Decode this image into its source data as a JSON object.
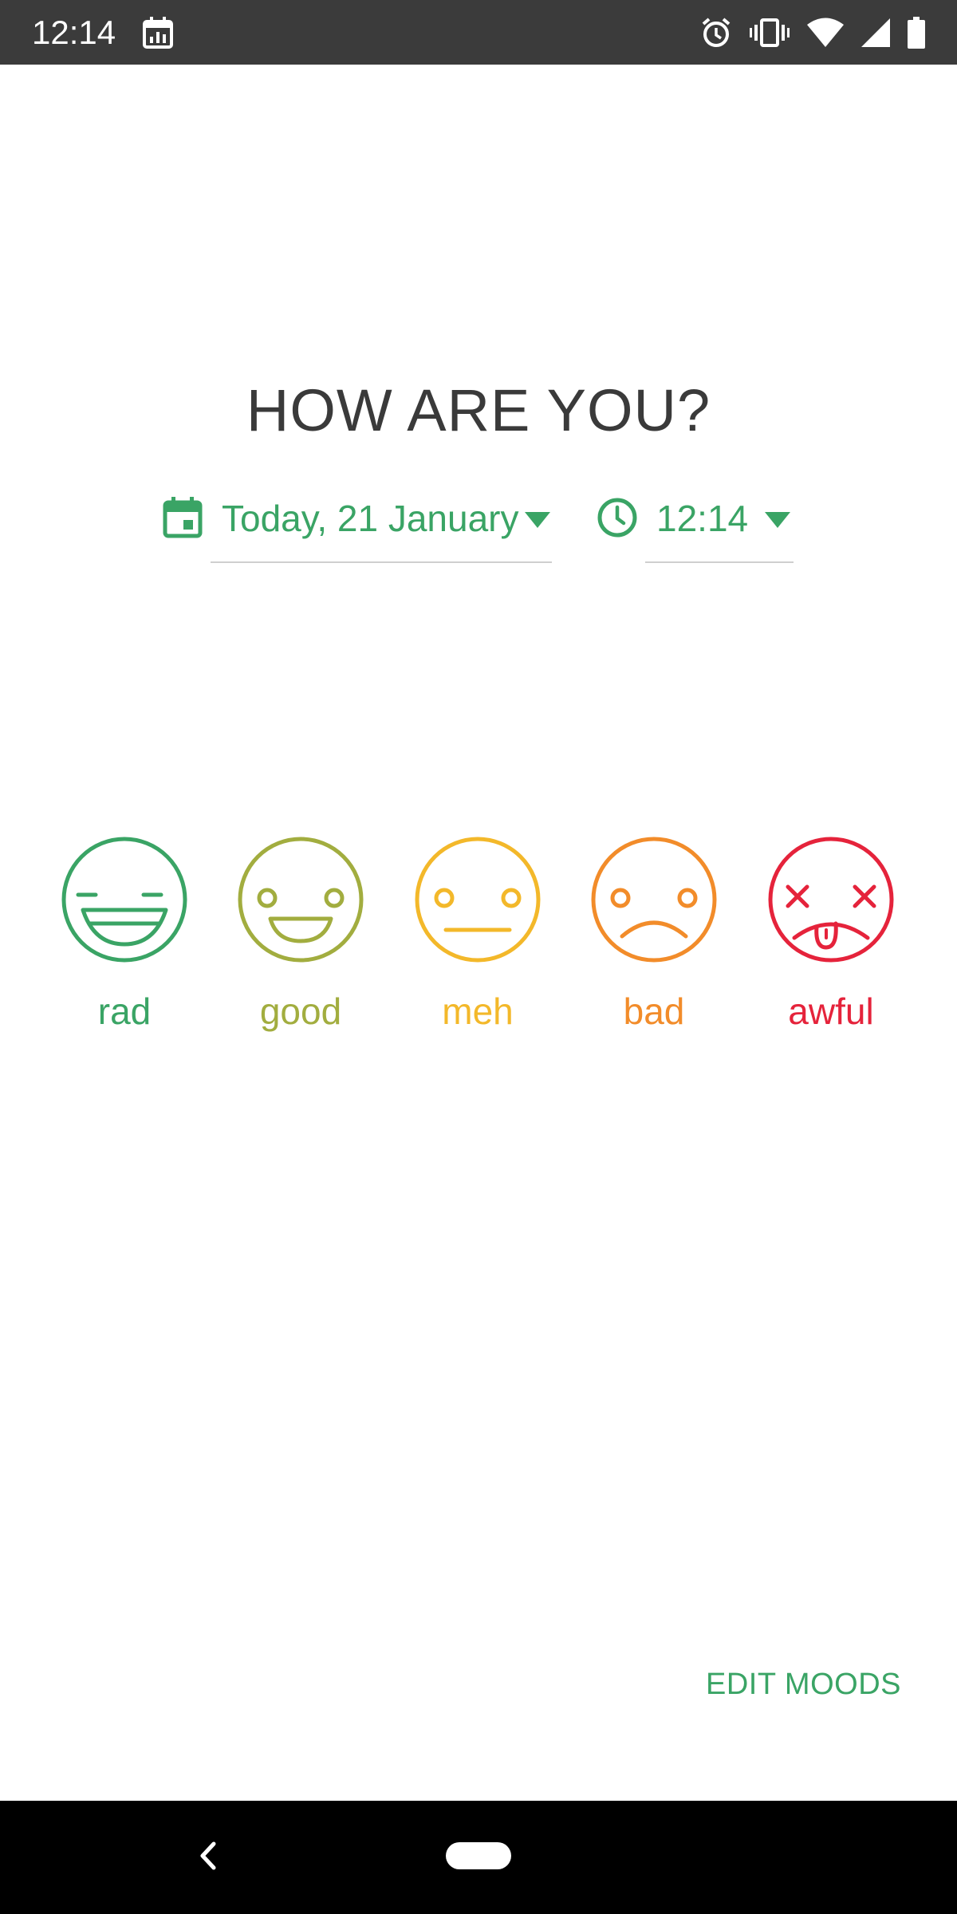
{
  "status_bar": {
    "time": "12:14",
    "left_icons": [
      "calendar-icon"
    ],
    "right_icons": [
      "alarm-icon",
      "vibrate-icon",
      "wifi-icon",
      "signal-icon",
      "battery-icon"
    ]
  },
  "title": "HOW ARE YOU?",
  "date_selector": {
    "value": "Today, 21 January",
    "icon": "calendar-icon"
  },
  "time_selector": {
    "value": "12:14",
    "icon": "clock-icon"
  },
  "moods": [
    {
      "label": "rad",
      "color": "#3aa465",
      "icon": "rad-face-icon"
    },
    {
      "label": "good",
      "color": "#a2ad3f",
      "icon": "good-face-icon"
    },
    {
      "label": "meh",
      "color": "#f3b82a",
      "icon": "meh-face-icon"
    },
    {
      "label": "bad",
      "color": "#f28c2a",
      "icon": "bad-face-icon"
    },
    {
      "label": "awful",
      "color": "#e5233b",
      "icon": "awful-face-icon"
    }
  ],
  "edit_moods": "EDIT MOODS",
  "colors": {
    "accent": "#3aa465",
    "status_bar": "#3b3b3b",
    "nav_bar": "#000000",
    "title_text": "#3a3a3a"
  }
}
